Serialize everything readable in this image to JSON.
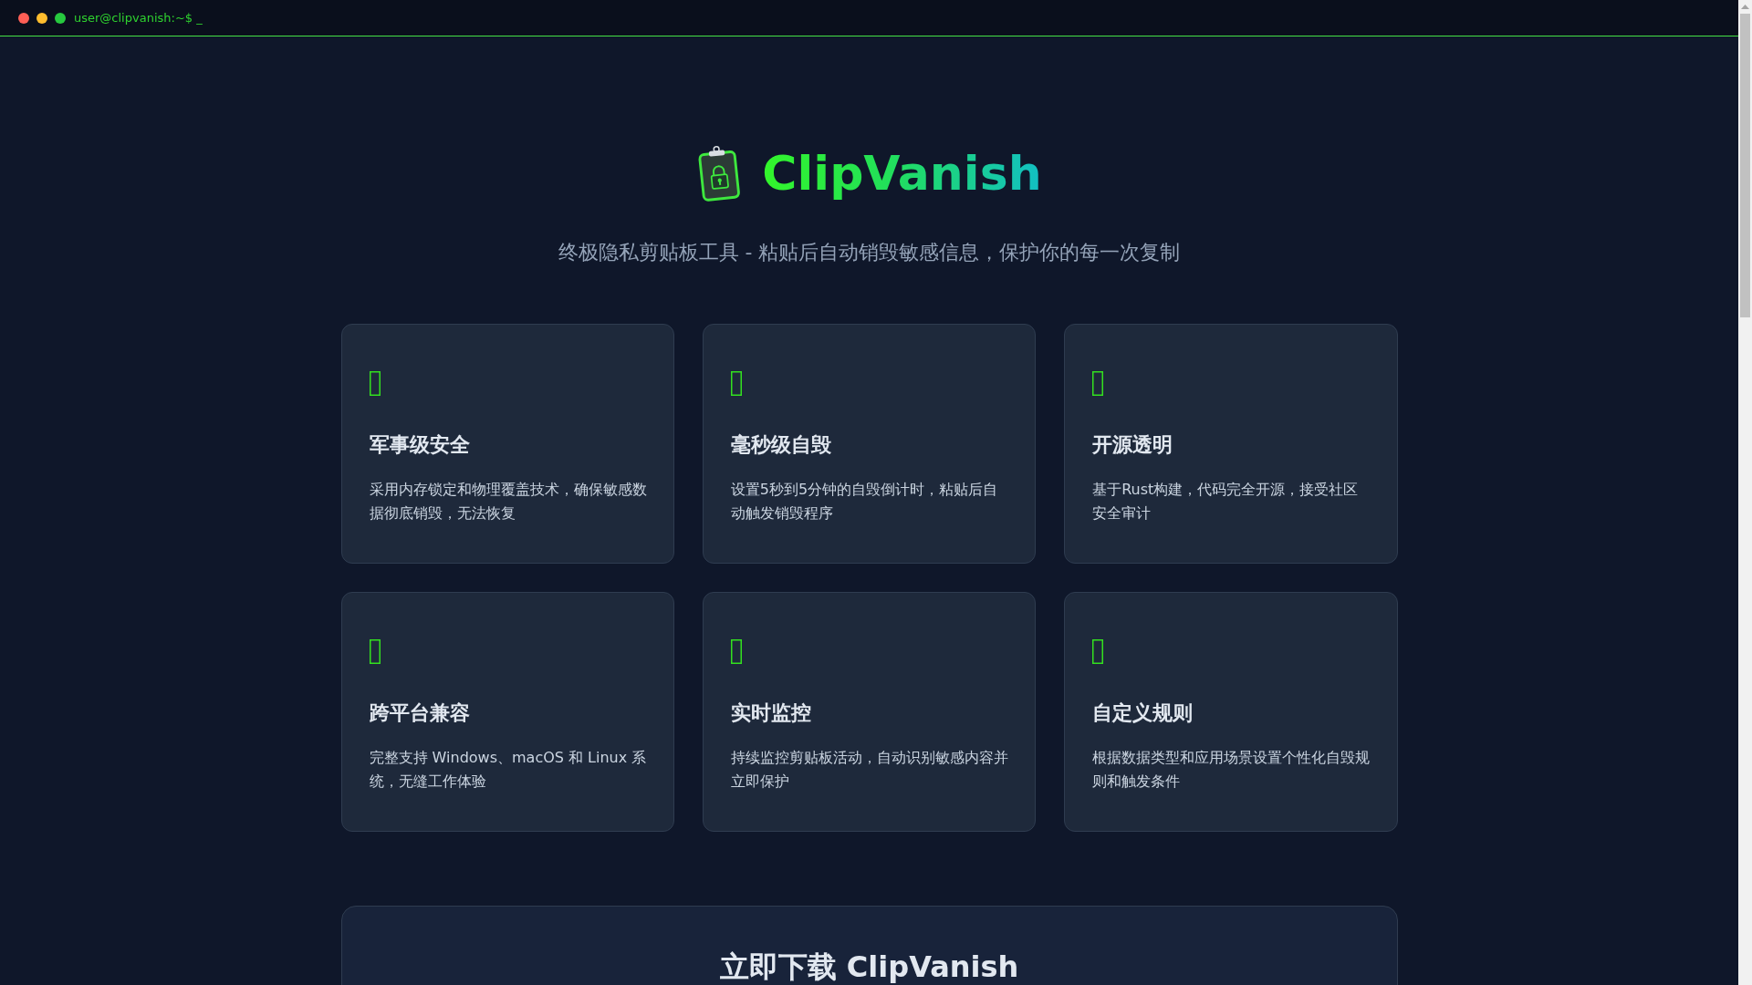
{
  "terminal_bar": {
    "prompt": "user@clipvanish:~$ _"
  },
  "hero": {
    "title": "ClipVanish",
    "subtitle": "终极隐私剪贴板工具 - 粘贴后自动销毁敏感信息，保护你的每一次复制"
  },
  "features": [
    {
      "title": "军事级安全",
      "description": "采用内存锁定和物理覆盖技术，确保敏感数据彻底销毁，无法恢复"
    },
    {
      "title": "毫秒级自毁",
      "description": "设置5秒到5分钟的自毁倒计时，粘贴后自动触发销毁程序"
    },
    {
      "title": "开源透明",
      "description": "基于Rust构建，代码完全开源，接受社区安全审计"
    },
    {
      "title": "跨平台兼容",
      "description": "完整支持 Windows、macOS 和 Linux 系统，无缝工作体验"
    },
    {
      "title": "实时监控",
      "description": "持续监控剪贴板活动，自动识别敏感内容并立即保护"
    },
    {
      "title": "自定义规则",
      "description": "根据数据类型和应用场景设置个性化自毁规则和触发条件"
    }
  ],
  "download": {
    "title": "立即下载 ClipVanish"
  }
}
